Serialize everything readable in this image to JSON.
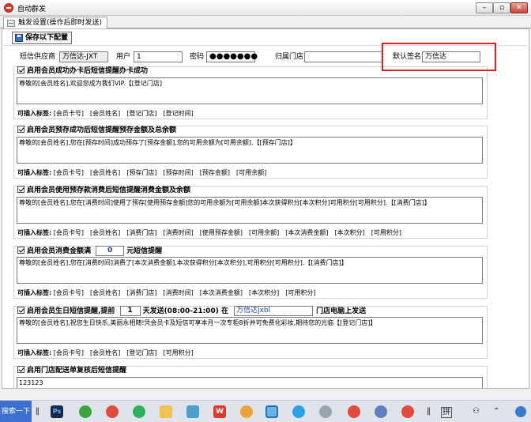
{
  "window": {
    "title": "自动群发",
    "minimize": "–",
    "restore": "▫",
    "close": "✕"
  },
  "tab": {
    "label": "触发设置(操作后即时发送)"
  },
  "toolbar": {
    "save_label": "保存以下配置"
  },
  "config": {
    "provider_label": "短信供应商",
    "provider_value": "万信达-JXT",
    "user_label": "用户",
    "user_value": "1",
    "password_label": "密码",
    "password_value": "●●●●●●●",
    "store_label": "归属门店",
    "store_value": "",
    "signature_label": "默认签名",
    "signature_value": "万信达"
  },
  "insert_tags_label": "可插入标签:",
  "sections": [
    {
      "title": "启用会员成功办卡后短信提醒办卡成功",
      "message": "尊敬的[会员姓名],欢迎您成为我们VIP.【[登记门店]",
      "tags": [
        "[会员卡号]",
        "[会员姓名]",
        "[登记门店]",
        "[登记时间]"
      ]
    },
    {
      "title": "启用会员预存成功后短信提醒预存金额及总余额",
      "message": "尊敬的[会员姓名],您在[预存时间]成功预存了[预存金额],您的可用余额为[可用余额].【[预存门店]】",
      "tags": [
        "[会员卡号]",
        "[会员姓名]",
        "[预存门店]",
        "[预存时间]",
        "[预存金额]",
        "[可用余额]"
      ]
    },
    {
      "title": "启用会员使用预存款消费后短信提醒消费金额及余额",
      "message": "尊敬的[会员姓名],您在[消费时间]使用了预存[使用预存金额]您的可用余额为[可用余额]本次获得积分[本次积分]可用积分[可用积分].【[消费门店]】",
      "tags": [
        "[会员卡号]",
        "[会员姓名]",
        "[消费门店]",
        "[消费时间]",
        "[使用预存金额]",
        "[可用余额]",
        "[本次消费金额]",
        "[本次积分]",
        "[可用积分]"
      ]
    },
    {
      "title": "启用会员消费金额满",
      "amount": "0",
      "title_suffix": "元短信提醒",
      "message": "尊敬的[会员姓名],您在[消费时间]消费了[本次消费金额],本次获得积分[本次积分],可用积分[可用积分].【[消费门店]】",
      "tags": [
        "[会员卡号]",
        "[会员姓名]",
        "[消费门店]",
        "[消费时间]",
        "[本次消费金额]",
        "[本次积分]",
        "[可用积分]"
      ]
    },
    {
      "title": "启用会员生日短信提醒,提前",
      "days": "1",
      "days_suffix": "天发送(08:00-21:00) 在",
      "store": "万信达jxbl",
      "store_suffix": "门店电脑上发送",
      "message": "尊敬的[会员姓名],祝您生日快乐,美丽永相随!凭会员卡及短信可享本月一次专柜8折并可免费化彩妆,期待您的光临【[登记门店]】",
      "tags": [
        "[会员卡号]",
        "[会员姓名]",
        "[登记门店]",
        "[可用积分]"
      ]
    },
    {
      "title": "启用门店配送单复核后短信提醒",
      "message": "123123"
    }
  ],
  "taskbar": {
    "search_label": "搜索一下",
    "ime": "拼"
  },
  "colors": {
    "highlight_box": "#e02020",
    "taskbar_search": "#3c6fd1",
    "close_button": "#c9463a"
  }
}
